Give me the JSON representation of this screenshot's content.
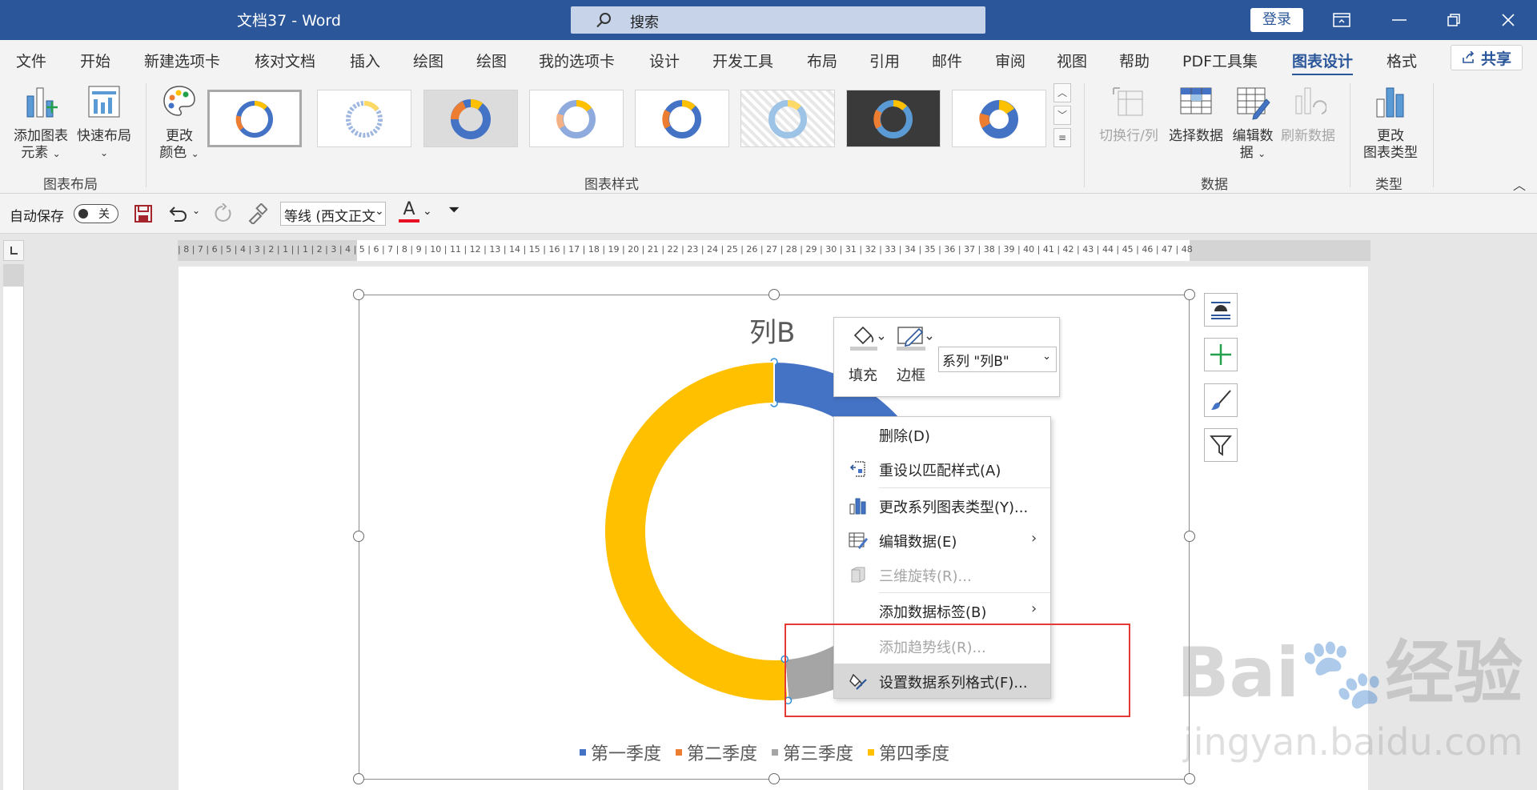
{
  "titlebar": {
    "doc_name": "文档37  -  Word",
    "search_placeholder": "搜索",
    "login": "登录"
  },
  "menu": {
    "tabs": [
      "文件",
      "开始",
      "新建选项卡",
      "核对文档",
      "插入",
      "绘图",
      "绘图",
      "我的选项卡",
      "设计",
      "开发工具",
      "布局",
      "引用",
      "邮件",
      "审阅",
      "视图",
      "帮助",
      "PDF工具集",
      "图表设计",
      "格式"
    ],
    "active_tab": "图表设计",
    "share": "共享"
  },
  "ribbon": {
    "add_element": "添加图表",
    "add_element2": "元素",
    "quick_layout": "快速布局",
    "change_colors": "更改",
    "change_colors2": "颜色",
    "group_layout": "图表布局",
    "group_styles": "图表样式",
    "switch_row_col": "切换行/列",
    "select_data": "选择数据",
    "edit_data": "编辑数",
    "edit_data2": "据",
    "refresh_data": "刷新数据",
    "group_data": "数据",
    "change_type": "更改",
    "change_type2": "图表类型",
    "group_type": "类型"
  },
  "qat": {
    "autosave": "自动保存",
    "autosave_state": "关",
    "font_name": "等线 (西文正文"
  },
  "ruler": {
    "h_numbers": "| 8 | 7 | 6 | 5 | 4 | 3 | 2 | 1 |   | 1 | 2 | 3 | 4 | 5 | 6 | 7 | 8 | 9 | 10 | 11 | 12 | 13 | 14 | 15 | 16 | 17 | 18 | 19 | 20 | 21 | 22 | 23 | 24 | 25 | 26 | 27 | 28 | 29 | 30 | 31 | 32 | 33 | 34 | 35 | 36 | 37 | 38 | 39 |  40 | 41 | 42 | 43 | 44 | 45 | 46 | 47 | 48"
  },
  "chart_data": {
    "type": "pie",
    "subtype": "doughnut",
    "title": "列B",
    "categories": [
      "第一季度",
      "第二季度",
      "第三季度",
      "第四季度"
    ],
    "values": [
      14,
      10,
      13,
      39
    ],
    "colors": [
      "#4472c4",
      "#ed7d31",
      "#a5a5a5",
      "#ffc000"
    ],
    "legend": "bottom"
  },
  "mini_toolbar": {
    "fill": "填充",
    "outline": "边框",
    "series_selector": "系列 \"列B\""
  },
  "context_menu": {
    "items": [
      {
        "label": "删除(D)",
        "disabled": false
      },
      {
        "label": "重设以匹配样式(A)",
        "disabled": false
      },
      {
        "label": "更改系列图表类型(Y)...",
        "disabled": false
      },
      {
        "label": "编辑数据(E)",
        "disabled": false
      },
      {
        "label": "三维旋转(R)...",
        "disabled": true
      },
      {
        "label": "添加数据标签(B)",
        "disabled": false
      },
      {
        "label": "添加趋势线(R)...",
        "disabled": true
      },
      {
        "label": "设置数据系列格式(F)...",
        "disabled": false
      }
    ]
  },
  "watermark": {
    "brand": "Bai",
    "brand2": "经验",
    "url": "jingyan.baidu.com"
  }
}
